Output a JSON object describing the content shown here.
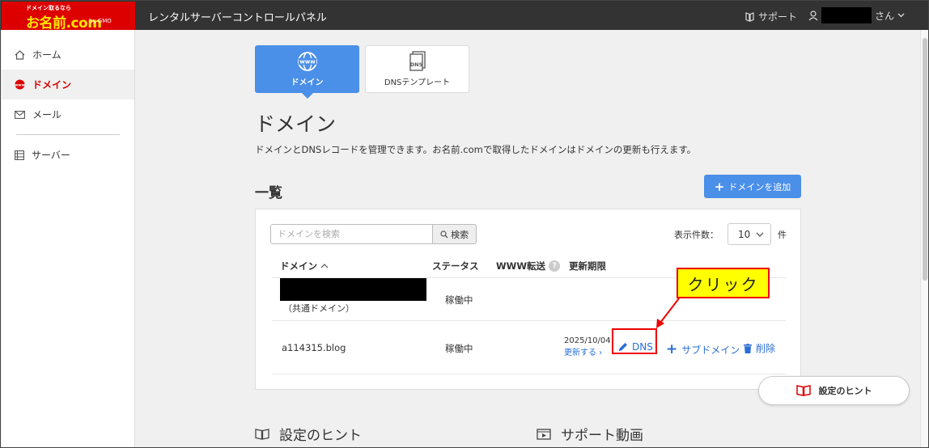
{
  "header": {
    "logo_tag": "ドメイン取るなら",
    "logo_main": "お名前.com",
    "logo_sub": "by GMO",
    "app_title": "レンタルサーバーコントロールパネル",
    "support_label": "サポート",
    "user_suffix": "さん"
  },
  "sidebar": {
    "items": [
      {
        "label": "ホーム"
      },
      {
        "label": "ドメイン",
        "icon_text": "www"
      },
      {
        "label": "メール"
      },
      {
        "label": "サーバー"
      }
    ]
  },
  "tabs": {
    "domain_label": "ドメイン",
    "domain_icon_text": "www",
    "dns_label": "DNSテンプレート",
    "dns_icon_text": "DNS"
  },
  "page": {
    "title": "ドメイン",
    "description": "ドメインとDNSレコードを管理できます。お名前.comで取得したドメインはドメインの更新も行えます。"
  },
  "list": {
    "section_title": "一覧",
    "add_button_label": "ドメインを追加",
    "search_placeholder": "ドメインを検索",
    "search_button_label": "検索",
    "per_page_label": "表示件数：",
    "per_page_value": "10",
    "per_page_unit": "件",
    "columns": {
      "domain": "ドメイン",
      "status": "ステータス",
      "www": "WWW転送",
      "expiry": "更新期限"
    },
    "rows": [
      {
        "note": "（共通ドメイン）",
        "status": "稼働中"
      },
      {
        "domain": "a114315.blog",
        "status": "稼働中",
        "expiry_date": "2025/10/04",
        "renew_label": "更新する",
        "dns_label": "DNS",
        "subdomain_label": "サブドメイン",
        "delete_label": "削除"
      }
    ]
  },
  "annotation": {
    "callout_text": "クリック",
    "colors": {
      "highlight": "#ee0000",
      "callout_bg": "#ffff00"
    }
  },
  "hint_button_label": "設定のヒント",
  "bottom": {
    "hints_title": "設定のヒント",
    "video_title": "サポート動画"
  },
  "colors": {
    "accent": "#4a8fe8",
    "brand": "#dd0000",
    "link": "#2a6fd4",
    "header_bg": "#333333"
  }
}
